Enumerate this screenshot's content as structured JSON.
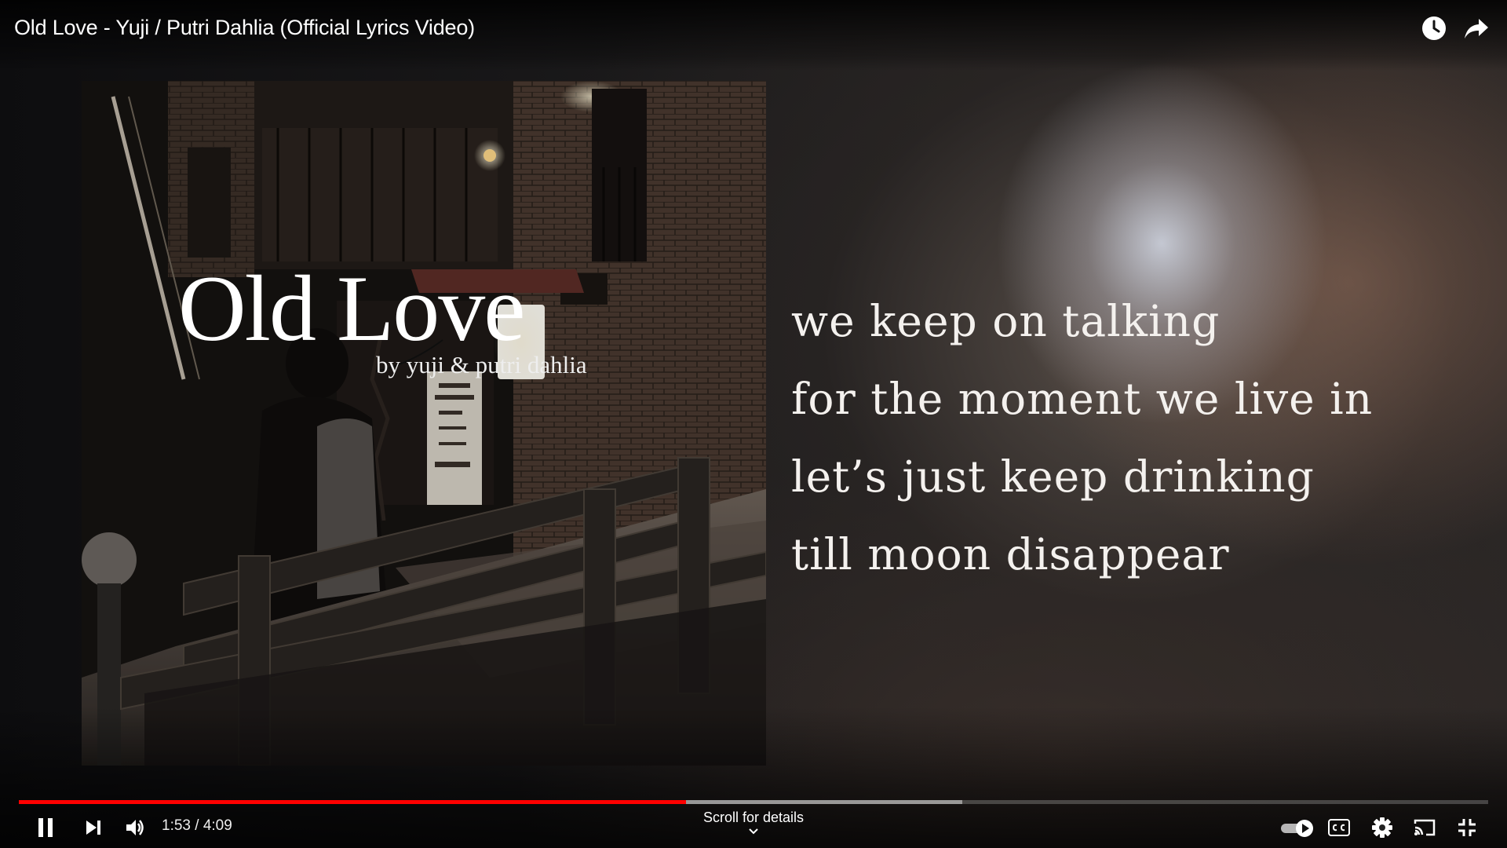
{
  "video": {
    "title": "Old Love - Yuji / Putri Dahlia (Official Lyrics Video)"
  },
  "artwork": {
    "title": "Old Love",
    "subtitle": "by yuji & putri dahlia"
  },
  "lyrics": [
    "we keep on talking",
    "for the moment we live in",
    "let’s just keep drinking",
    "till moon disappear"
  ],
  "controls": {
    "current_time": "1:53",
    "separator": " / ",
    "duration": "4:09",
    "scroll_hint": "Scroll for details",
    "played_fraction": 0.4538,
    "buffered_fraction": 0.642,
    "autoplay_on": true
  },
  "icons": {
    "watch_later": "clock-icon",
    "share": "share-arrow-icon",
    "pause": "pause-icon",
    "next": "next-icon",
    "volume": "volume-icon",
    "autoplay": "autoplay-toggle-icon",
    "captions": "cc-icon",
    "settings": "gear-icon",
    "cast": "cast-icon",
    "exit_fullscreen": "exit-fullscreen-icon"
  },
  "colors": {
    "progress_played": "#ff0000",
    "text": "#ffffff"
  }
}
